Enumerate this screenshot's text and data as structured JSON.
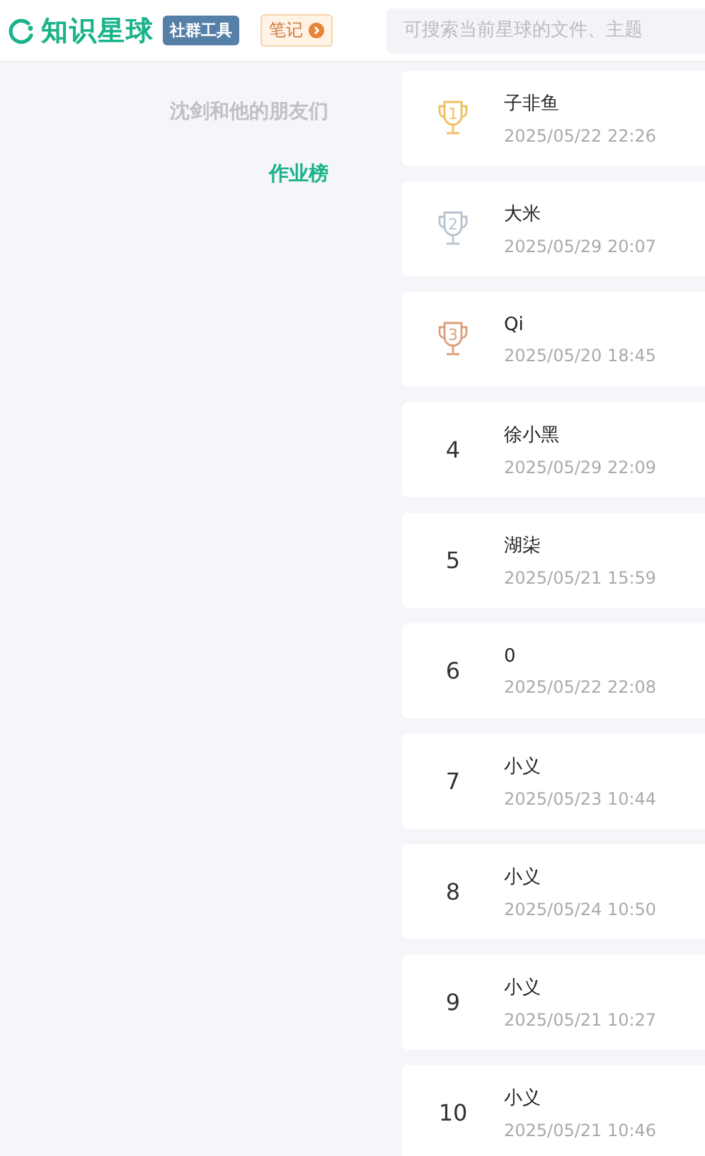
{
  "header": {
    "logo": "知识星球",
    "tag": "社群工具",
    "notes_button": "笔记",
    "search": {
      "placeholder": "可搜索当前星球的文件、主题"
    }
  },
  "sidebar": {
    "items": [
      {
        "label": "沈剑和他的朋友们",
        "selected": false
      },
      {
        "label": "作业榜",
        "selected": true
      }
    ]
  },
  "ranking": [
    {
      "rank": "1",
      "kind": "trophy",
      "color": "#f0c060",
      "name": "子非鱼",
      "time": "2025/05/22 22:26"
    },
    {
      "rank": "2",
      "kind": "trophy",
      "color": "#b8c2cc",
      "name": "大米",
      "time": "2025/05/29 20:07"
    },
    {
      "rank": "3",
      "kind": "trophy",
      "color": "#d9a07a",
      "name": "Qi",
      "time": "2025/05/20 18:45"
    },
    {
      "rank": "4",
      "kind": "plain",
      "name": "徐小黑",
      "time": "2025/05/29 22:09"
    },
    {
      "rank": "5",
      "kind": "plain",
      "name": "湖柒",
      "time": "2025/05/21 15:59"
    },
    {
      "rank": "6",
      "kind": "plain",
      "name": "0",
      "time": "2025/05/22 22:08"
    },
    {
      "rank": "7",
      "kind": "plain",
      "name": "小义",
      "time": "2025/05/23 10:44"
    },
    {
      "rank": "8",
      "kind": "plain",
      "name": "小义",
      "time": "2025/05/24 10:50"
    },
    {
      "rank": "9",
      "kind": "plain",
      "name": "小义",
      "time": "2025/05/21 10:27"
    },
    {
      "rank": "10",
      "kind": "plain",
      "name": "小义",
      "time": "2025/05/21 10:46"
    }
  ]
}
